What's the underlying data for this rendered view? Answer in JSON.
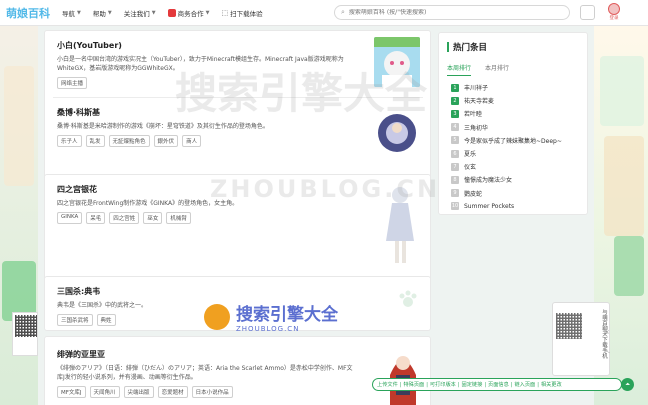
{
  "header": {
    "logo": "萌娘百科",
    "nav": [
      {
        "label": "导航",
        "chevron": true
      },
      {
        "label": "帮助",
        "chevron": true
      },
      {
        "label": "关注我们",
        "chevron": true
      },
      {
        "label": "商务合作",
        "chevron": true,
        "icon": "hot-badge-icon"
      },
      {
        "label": "扫下载体验",
        "chevron": false,
        "icon": "download-icon"
      }
    ],
    "search_placeholder": "搜索萌娘百科 (按/\"快速搜索)",
    "avatar_label": "登录"
  },
  "entries": [
    {
      "title": "小白(YouTuber)",
      "desc": "小白是一名中国台湾的游戏实况主（YouTuber），致力于Minecraft模组生存。Minecraft Java版游戏昵称为WhiteGX，基岩版游戏昵称为GGWhiteGX。",
      "tags": [
        "网络主播"
      ]
    },
    {
      "title": "桑博·科斯基",
      "desc": "桑博·科斯基是米哈游制作的游戏《崩坏：星穹铁道》及其衍生作品的登场角色。",
      "tags": [
        "乐子人",
        "乱发",
        "无証爆點角色",
        "銀外伏",
        "商人"
      ]
    },
    {
      "title": "四之宫银花",
      "desc": "四之宫银花是FrontWing制作游戏《GINKA》的登场角色，女主角。",
      "tags": [
        "GINKA",
        "呆毛",
        "四之宫姓",
        "巫女",
        "机械臂"
      ]
    },
    {
      "title": "三国杀:典韦",
      "desc": "典韦是《三国杀》中的武将之一。",
      "tags": [
        "三国杀武将",
        "典姓"
      ]
    },
    {
      "title": "绯弹的亚里亚",
      "desc": "《绯弾のアリア》（日语：緋弾（ひだん）のアリア；英语：Aria the Scarlet Ammo）是赤松中学创作、MF文库J发行的轻小说系列，并有漫画、动画等衍生作品。",
      "tags": [
        "MF文库J",
        "天闻角川",
        "尖端出版",
        "恋爱题材",
        "日本小说作品"
      ]
    }
  ],
  "hot": {
    "title": "热门条目",
    "tabs": [
      "本周排行",
      "本月排行"
    ],
    "items": [
      {
        "rank": "1",
        "name": "丰川祥子"
      },
      {
        "rank": "2",
        "name": "祐天寺若麦"
      },
      {
        "rank": "3",
        "name": "若叶睦"
      },
      {
        "rank": "4",
        "name": "三角初华"
      },
      {
        "rank": "5",
        "name": "今是家似乎成了辣妹聚集地~Deep~"
      },
      {
        "rank": "6",
        "name": "夏乐"
      },
      {
        "rank": "7",
        "name": "仪玄"
      },
      {
        "rank": "8",
        "name": "憧憬成为魔法少女"
      },
      {
        "rank": "9",
        "name": "鹦皮蛇"
      },
      {
        "rank": "10",
        "name": "Summer Pockets"
      }
    ]
  },
  "float_panel": {
    "text": "与萌百聊天下载手机"
  },
  "watermark": {
    "cn": "搜索引擎大全",
    "en": "ZHOUBLOG.CN"
  },
  "linkbar": {
    "links": [
      "上传文件",
      "特殊页面",
      "可打印版本",
      "固定链接",
      "页面信息",
      "链入页面",
      "相关更改"
    ]
  },
  "colors": {
    "accent": "#2aa35a",
    "logo": "#52b9e8"
  }
}
